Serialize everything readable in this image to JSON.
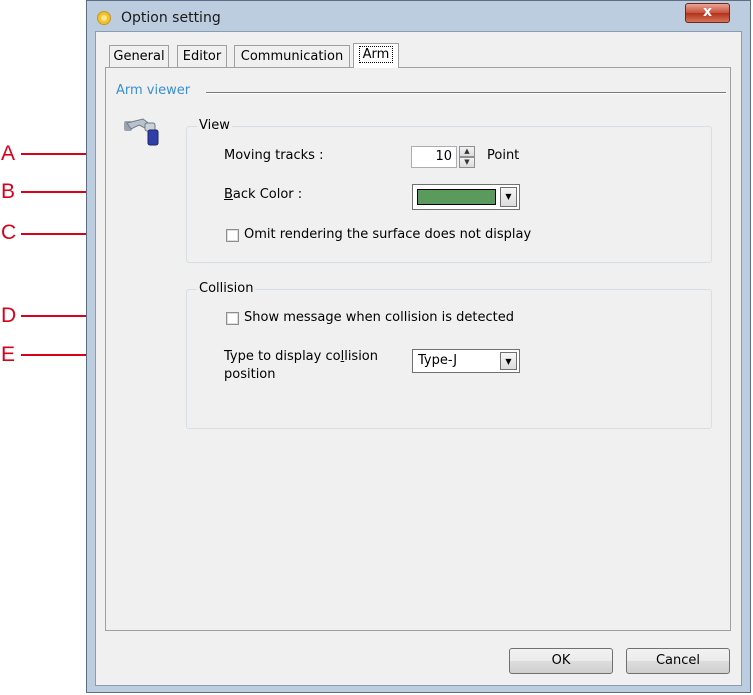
{
  "window": {
    "title": "Option setting",
    "close_label": "x"
  },
  "tabs": [
    {
      "label": "General"
    },
    {
      "label": "Editor"
    },
    {
      "label": "Communication"
    },
    {
      "label": "Arm"
    }
  ],
  "section": {
    "label": "Arm viewer"
  },
  "view_group": {
    "title": "View",
    "moving_tracks_label": "Moving tracks :",
    "moving_tracks_value": "10",
    "moving_tracks_unit": "Point",
    "back_color_accel": "B",
    "back_color_label": "ack Color :",
    "back_color_value": "#5b9a5d",
    "omit_label": "Omit rendering the surface does not display",
    "omit_checked": false
  },
  "collision_group": {
    "title": "Collision",
    "show_message_label": "Show message when collision is detected",
    "show_message_checked": false,
    "type_label_line1_a": "Type to display co",
    "type_label_line1_accel": "l",
    "type_label_line1_b": "lision",
    "type_label_line2": "position",
    "type_value": "Type-J"
  },
  "buttons": {
    "ok": "OK",
    "cancel": "Cancel"
  },
  "callouts": [
    "A",
    "B",
    "C",
    "D",
    "E"
  ],
  "colors": {
    "callout": "#d9001b",
    "accent": "#3a8ed4"
  }
}
